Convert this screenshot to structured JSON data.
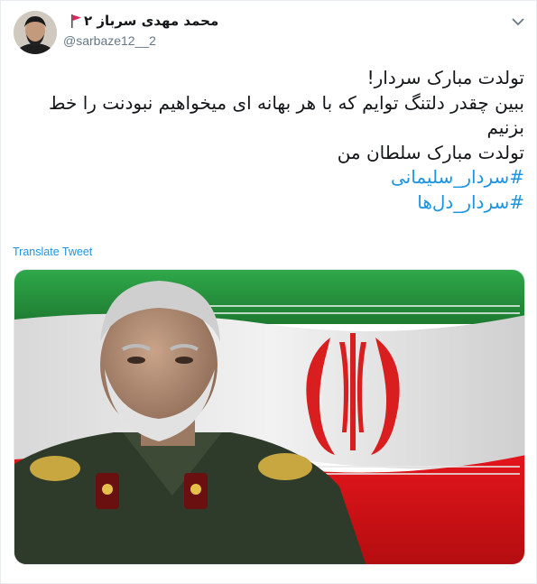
{
  "tweet": {
    "display_name": "محمد مهدی سرباز ۲",
    "handle": "@sarbaze12__2",
    "text_lines": [
      "تولدت مبارک سردار!",
      "ببین چقدر دلتنگ توایم که با هر بهانه ای میخواهیم نبودنت را خط بزنیم",
      "تولدت مبارک سلطان من"
    ],
    "hashtags": [
      "#سردار_سلیمانی",
      "#سردار_دل‌ها"
    ],
    "translate_label": "Translate Tweet"
  },
  "icons": {
    "flag": "red-flag-icon",
    "caret": "chevron-down-icon"
  },
  "colors": {
    "link": "#1b95e0",
    "handle": "#657786",
    "flag_green": "#239f40",
    "flag_red": "#da0000"
  }
}
